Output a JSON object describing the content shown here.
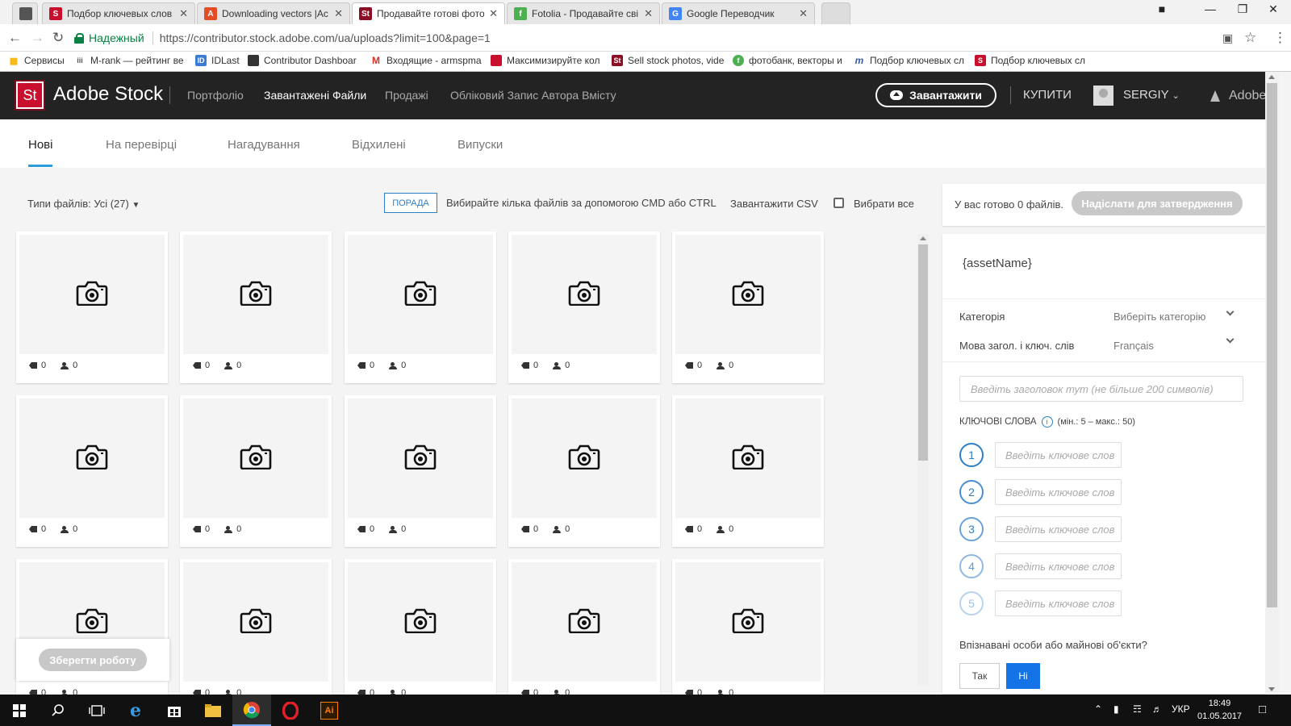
{
  "browser": {
    "tabs": [
      {
        "title": "Подбор ключевых слов",
        "favicon": "S",
        "color": "#c8102e"
      },
      {
        "title": "Downloading vectors |Ac",
        "favicon": "A",
        "color": "#e34c26"
      },
      {
        "title": "Продавайте готові фото",
        "favicon": "St",
        "color": "#8b0e24"
      },
      {
        "title": "Fotolia - Продавайте сві",
        "favicon": "f",
        "color": "#4caf50"
      },
      {
        "title": "Google Переводчик",
        "favicon": "G",
        "color": "#4285f4"
      }
    ],
    "secure_label": "Надежный",
    "url": "https://contributor.stock.adobe.com/ua/uploads?limit=100&page=1",
    "bookmarks": [
      {
        "label": "Сервисы",
        "icon": "apps-icon",
        "color": "#f4b400"
      },
      {
        "label": "M-rank — рейтинг ве",
        "icon": "iii",
        "color": "#555555"
      },
      {
        "label": "IDLast",
        "icon": "ID",
        "color": "#3a7bd5"
      },
      {
        "label": "Contributor Dashboar",
        "icon": "",
        "color": "#333333"
      },
      {
        "label": "Входящие - armspma",
        "icon": "M",
        "color": "#d93025"
      },
      {
        "label": "Максимизируйте кол",
        "icon": "",
        "color": "#c8102e"
      },
      {
        "label": "Sell stock photos, vide",
        "icon": "St",
        "color": "#8b0e24"
      },
      {
        "label": "фотобанк, векторы и",
        "icon": "f",
        "color": "#4caf50"
      },
      {
        "label": "Подбор ключевых сл",
        "icon": "m",
        "color": "#3a5a9b"
      },
      {
        "label": "Подбор ключевых сл",
        "icon": "S",
        "color": "#c8102e"
      }
    ]
  },
  "header": {
    "logo_text": "St",
    "brand": "Adobe Stock",
    "nav": [
      "Портфоліо",
      "Завантажені Файли",
      "Продажі",
      "Обліковий Запис Автора Вмісту"
    ],
    "upload_label": "Завантажити",
    "buy_label": "КУПИТИ",
    "user": "SERGIY",
    "adobe_label": "Adobe"
  },
  "subtabs": [
    "Нові",
    "На перевірці",
    "Нагадування",
    "Відхилені",
    "Випуски"
  ],
  "toolbar": {
    "file_types": "Типи файлів: Усі (27)",
    "hint_badge": "ПОРАДА",
    "hint_text": "Вибирайте кілька файлів за допомогою CMD або CTRL",
    "csv": "Завантажити CSV",
    "select_all": "Вибрати все"
  },
  "grid": {
    "keywords_count": "0",
    "people_count": "0"
  },
  "save_label": "Зберегти роботу",
  "panel": {
    "ready_text": "У вас готово 0 файлів.",
    "submit_label": "Надіслати для затвердження",
    "asset_name": "{assetName}",
    "category_label": "Категорія",
    "category_value": "Виберіть категорію",
    "lang_label": "Мова загол. і ключ. слів",
    "lang_value": "Français",
    "title_placeholder": "Введіть заголовок тут (не більше 200 символів)",
    "keywords_label": "КЛЮЧОВІ СЛОВА",
    "keywords_range": "(мін.: 5 – макс.: 50)",
    "keyword_placeholder": "Введіть ключове слов",
    "keyword_numbers": [
      "1",
      "2",
      "3",
      "4",
      "5"
    ],
    "people_question": "Впізнавані особи або майнові об'єкти?",
    "yes": "Так",
    "no": "Ні"
  },
  "taskbar": {
    "lang": "УКР",
    "time": "18:49",
    "date": "01.05.2017"
  },
  "colors": {
    "accent": "#2d9cdb",
    "brand_red": "#c8102e",
    "primary_blue": "#1473e6"
  }
}
